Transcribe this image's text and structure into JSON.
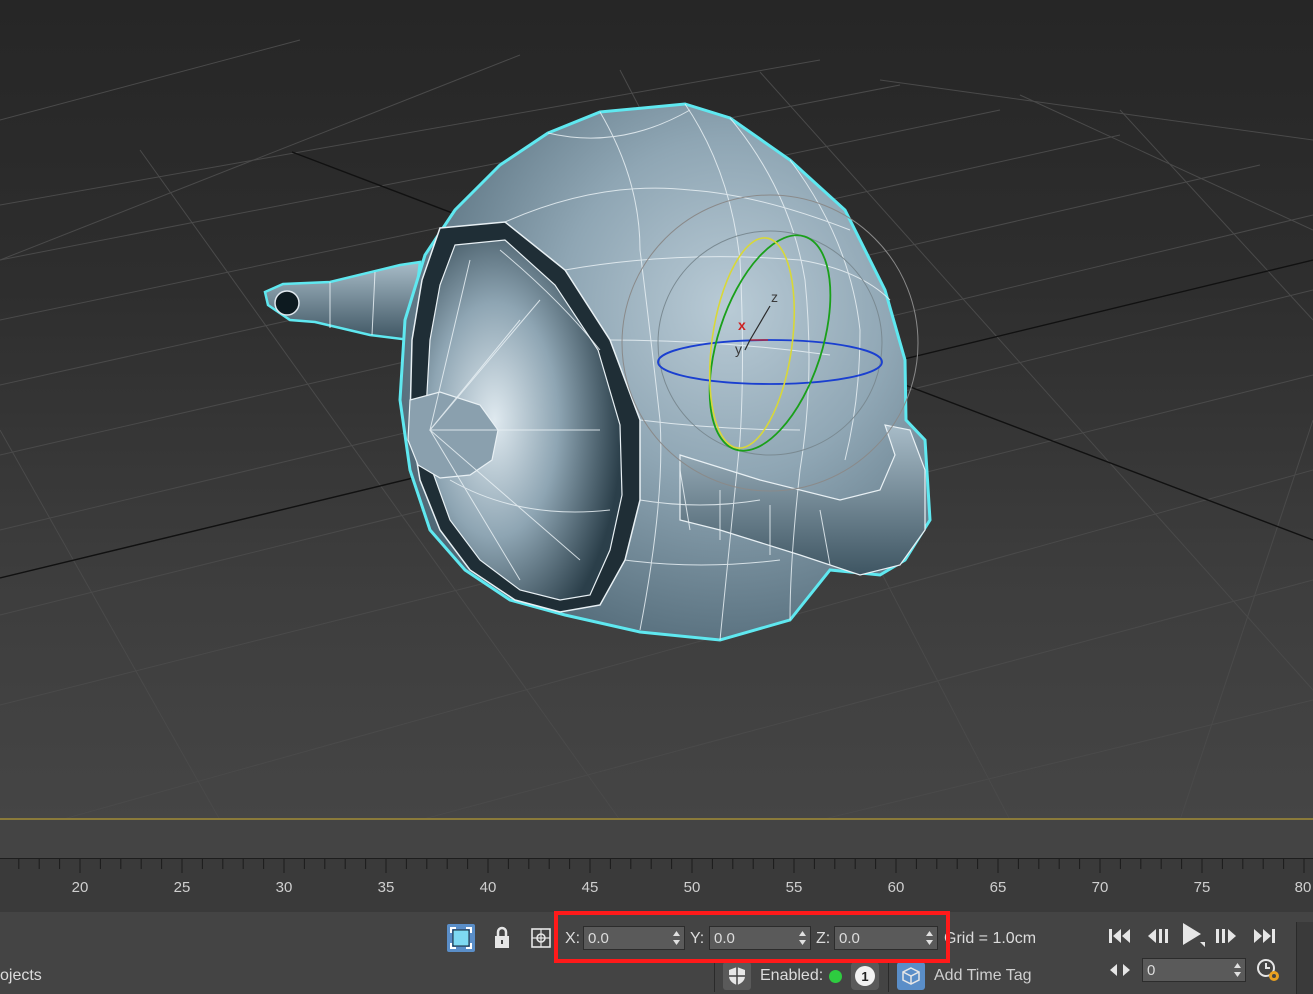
{
  "viewport": {
    "gizmo_axes": {
      "x": "x",
      "y": "y",
      "z": "z"
    }
  },
  "timeline": {
    "ticks": [
      "20",
      "25",
      "30",
      "35",
      "40",
      "45",
      "50",
      "55",
      "60",
      "65",
      "70",
      "75",
      "80"
    ]
  },
  "status_bar": {
    "selection_text": "ojects",
    "coords": {
      "x_label": "X:",
      "x_value": "0.0",
      "y_label": "Y:",
      "y_value": "0.0",
      "z_label": "Z:",
      "z_value": "0.0"
    },
    "grid_text": "Grid = 1.0cm",
    "enabled_label": "Enabled:",
    "enabled_badge": "1",
    "add_time_tag": "Add Time Tag",
    "frame_value": "0"
  },
  "icons": {
    "selection_mode": "selection-mode-icon",
    "lock": "lock-icon",
    "transform_type_in": "absolute-mode-icon",
    "shield": "shield-icon",
    "status_dot": "green-dot-icon",
    "time_tag": "time-tag-icon",
    "playback": [
      "go-to-start-icon",
      "previous-frame-icon",
      "play-icon",
      "next-frame-icon",
      "go-to-end-icon"
    ],
    "key_mode": "key-mode-icon",
    "time_config": "time-config-icon"
  },
  "colors": {
    "highlight": "#ff1a1a",
    "selection_outline": "#5fe8f0",
    "status_green": "#2ecc40"
  }
}
